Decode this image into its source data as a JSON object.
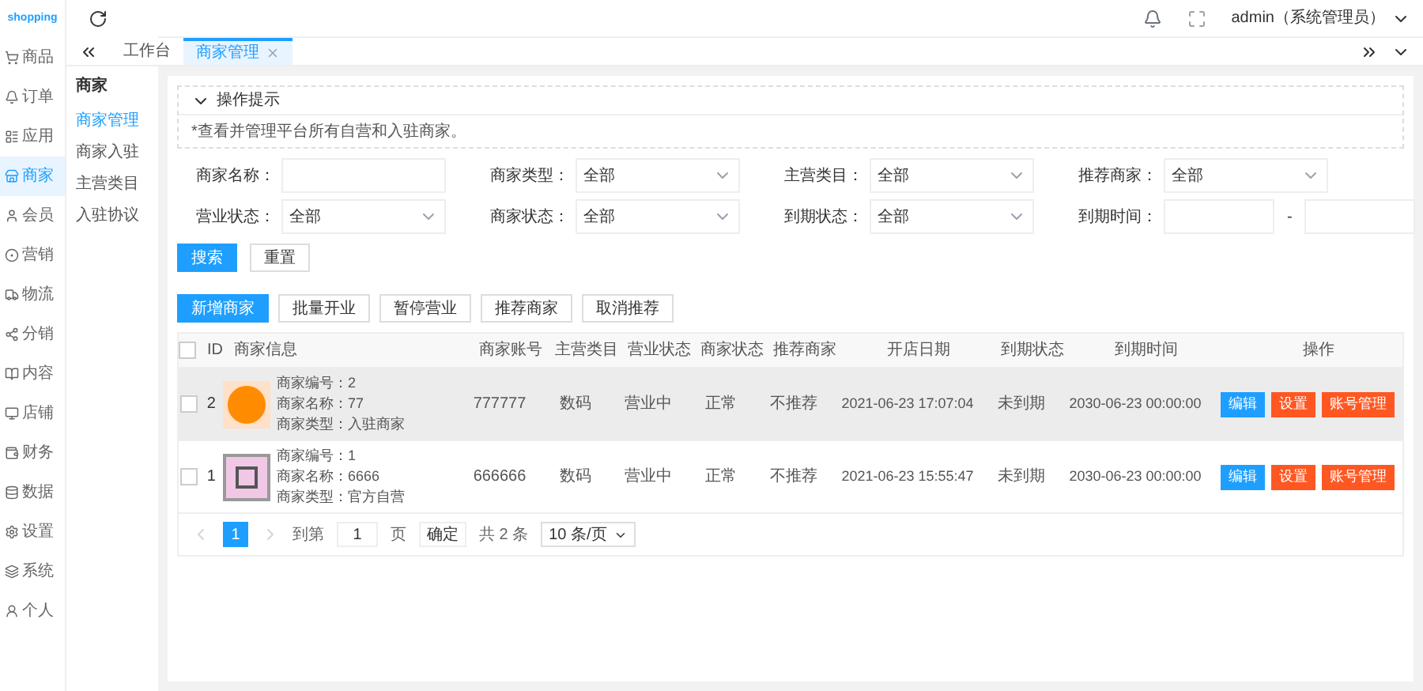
{
  "logo": {
    "text": "shopping"
  },
  "sidebar": {
    "items": [
      {
        "label": "商品",
        "selected": false
      },
      {
        "label": "订单",
        "selected": false
      },
      {
        "label": "应用",
        "selected": false
      },
      {
        "label": "商家",
        "selected": true
      },
      {
        "label": "会员",
        "selected": false
      },
      {
        "label": "营销",
        "selected": false
      },
      {
        "label": "物流",
        "selected": false
      },
      {
        "label": "分销",
        "selected": false
      },
      {
        "label": "内容",
        "selected": false
      },
      {
        "label": "店铺",
        "selected": false
      },
      {
        "label": "财务",
        "selected": false
      },
      {
        "label": "数据",
        "selected": false
      },
      {
        "label": "设置",
        "selected": false
      },
      {
        "label": "系统",
        "selected": false
      },
      {
        "label": "个人",
        "selected": false
      }
    ]
  },
  "submenu": {
    "title": "商家",
    "items": [
      {
        "label": "商家管理",
        "selected": true
      },
      {
        "label": "商家入驻",
        "selected": false
      },
      {
        "label": "主营类目",
        "selected": false
      },
      {
        "label": "入驻协议",
        "selected": false
      }
    ]
  },
  "header": {
    "user": "admin（系统管理员）"
  },
  "tabs": [
    {
      "label": "工作台",
      "selected": false,
      "closable": false
    },
    {
      "label": "商家管理",
      "selected": true,
      "closable": true
    }
  ],
  "tip": {
    "title": "操作提示",
    "expanded": true,
    "text": "*查看并管理平台所有自营和入驻商家。"
  },
  "filters": [
    {
      "kind": "input",
      "label": "商家名称："
    },
    {
      "kind": "select",
      "label": "商家类型：",
      "value": "全部"
    },
    {
      "kind": "select",
      "label": "主营类目：",
      "value": "全部"
    },
    {
      "kind": "select",
      "label": "推荐商家：",
      "value": "全部"
    },
    {
      "kind": "select",
      "label": "营业状态：",
      "value": "全部"
    },
    {
      "kind": "select",
      "label": "商家状态：",
      "value": "全部"
    },
    {
      "kind": "select",
      "label": "到期状态：",
      "value": "全部"
    },
    {
      "kind": "daterange",
      "label": "到期时间：",
      "separator": "-"
    }
  ],
  "filter_buttons": [
    {
      "label": "搜索",
      "kind": "primary"
    },
    {
      "label": "重置",
      "kind": "default"
    }
  ],
  "actions": [
    {
      "label": "新增商家",
      "kind": "primary"
    },
    {
      "label": "批量开业",
      "kind": "default"
    },
    {
      "label": "暂停营业",
      "kind": "default"
    },
    {
      "label": "推荐商家",
      "kind": "default"
    },
    {
      "label": "取消推荐",
      "kind": "default"
    }
  ],
  "table": {
    "select_all": {
      "checked": false
    },
    "columns": [
      "ID",
      "商家信息",
      "商家账号",
      "主营类目",
      "营业状态",
      "商家状态",
      "推荐商家",
      "开店日期",
      "到期状态",
      "到期时间",
      "操作"
    ],
    "rows": [
      {
        "checked": false,
        "highlighted": true,
        "logo": {
          "kind": "circle"
        },
        "id": "2",
        "info": [
          "商家编号：2",
          "商家名称：77",
          "商家类型：入驻商家"
        ],
        "account": "777777",
        "category": "数码",
        "business": "营业中",
        "status": "正常",
        "recommend": "不推荐",
        "opened": "2021-06-23 17:07:04",
        "expiry_status": "未到期",
        "expiry": "2030-06-23 00:00:00",
        "buttons": [
          {
            "label": "编辑",
            "kind": "primary"
          },
          {
            "label": "设置",
            "kind": "danger"
          },
          {
            "label": "账号管理",
            "kind": "danger"
          }
        ]
      },
      {
        "checked": false,
        "highlighted": false,
        "logo": {
          "kind": "square"
        },
        "id": "1",
        "info": [
          "商家编号：1",
          "商家名称：6666",
          "商家类型：官方自营"
        ],
        "account": "666666",
        "category": "数码",
        "business": "营业中",
        "status": "正常",
        "recommend": "不推荐",
        "opened": "2021-06-23 15:55:47",
        "expiry_status": "未到期",
        "expiry": "2030-06-23 00:00:00",
        "buttons": [
          {
            "label": "编辑",
            "kind": "primary"
          },
          {
            "label": "设置",
            "kind": "danger"
          },
          {
            "label": "账号管理",
            "kind": "danger"
          }
        ]
      }
    ]
  },
  "pagination": {
    "pages": [
      {
        "label": "1",
        "selected": true
      }
    ],
    "goto_label": "到第",
    "page_value": "1",
    "page_unit": "页",
    "confirm": "确定",
    "total": "共 2 条",
    "page_size": "10 条/页"
  }
}
